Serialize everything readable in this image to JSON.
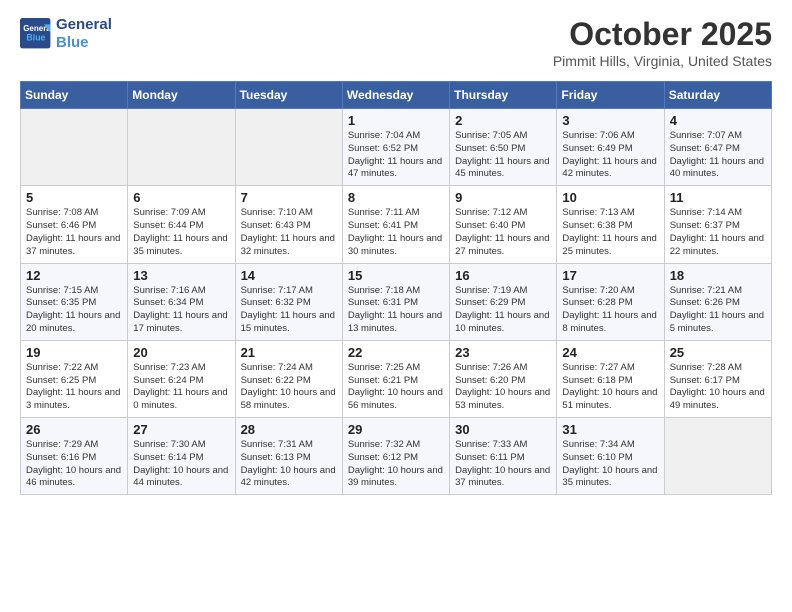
{
  "header": {
    "logo_line1": "General",
    "logo_line2": "Blue",
    "month": "October 2025",
    "location": "Pimmit Hills, Virginia, United States"
  },
  "days_of_week": [
    "Sunday",
    "Monday",
    "Tuesday",
    "Wednesday",
    "Thursday",
    "Friday",
    "Saturday"
  ],
  "weeks": [
    [
      {
        "day": "",
        "info": ""
      },
      {
        "day": "",
        "info": ""
      },
      {
        "day": "",
        "info": ""
      },
      {
        "day": "1",
        "info": "Sunrise: 7:04 AM\nSunset: 6:52 PM\nDaylight: 11 hours and 47 minutes."
      },
      {
        "day": "2",
        "info": "Sunrise: 7:05 AM\nSunset: 6:50 PM\nDaylight: 11 hours and 45 minutes."
      },
      {
        "day": "3",
        "info": "Sunrise: 7:06 AM\nSunset: 6:49 PM\nDaylight: 11 hours and 42 minutes."
      },
      {
        "day": "4",
        "info": "Sunrise: 7:07 AM\nSunset: 6:47 PM\nDaylight: 11 hours and 40 minutes."
      }
    ],
    [
      {
        "day": "5",
        "info": "Sunrise: 7:08 AM\nSunset: 6:46 PM\nDaylight: 11 hours and 37 minutes."
      },
      {
        "day": "6",
        "info": "Sunrise: 7:09 AM\nSunset: 6:44 PM\nDaylight: 11 hours and 35 minutes."
      },
      {
        "day": "7",
        "info": "Sunrise: 7:10 AM\nSunset: 6:43 PM\nDaylight: 11 hours and 32 minutes."
      },
      {
        "day": "8",
        "info": "Sunrise: 7:11 AM\nSunset: 6:41 PM\nDaylight: 11 hours and 30 minutes."
      },
      {
        "day": "9",
        "info": "Sunrise: 7:12 AM\nSunset: 6:40 PM\nDaylight: 11 hours and 27 minutes."
      },
      {
        "day": "10",
        "info": "Sunrise: 7:13 AM\nSunset: 6:38 PM\nDaylight: 11 hours and 25 minutes."
      },
      {
        "day": "11",
        "info": "Sunrise: 7:14 AM\nSunset: 6:37 PM\nDaylight: 11 hours and 22 minutes."
      }
    ],
    [
      {
        "day": "12",
        "info": "Sunrise: 7:15 AM\nSunset: 6:35 PM\nDaylight: 11 hours and 20 minutes."
      },
      {
        "day": "13",
        "info": "Sunrise: 7:16 AM\nSunset: 6:34 PM\nDaylight: 11 hours and 17 minutes."
      },
      {
        "day": "14",
        "info": "Sunrise: 7:17 AM\nSunset: 6:32 PM\nDaylight: 11 hours and 15 minutes."
      },
      {
        "day": "15",
        "info": "Sunrise: 7:18 AM\nSunset: 6:31 PM\nDaylight: 11 hours and 13 minutes."
      },
      {
        "day": "16",
        "info": "Sunrise: 7:19 AM\nSunset: 6:29 PM\nDaylight: 11 hours and 10 minutes."
      },
      {
        "day": "17",
        "info": "Sunrise: 7:20 AM\nSunset: 6:28 PM\nDaylight: 11 hours and 8 minutes."
      },
      {
        "day": "18",
        "info": "Sunrise: 7:21 AM\nSunset: 6:26 PM\nDaylight: 11 hours and 5 minutes."
      }
    ],
    [
      {
        "day": "19",
        "info": "Sunrise: 7:22 AM\nSunset: 6:25 PM\nDaylight: 11 hours and 3 minutes."
      },
      {
        "day": "20",
        "info": "Sunrise: 7:23 AM\nSunset: 6:24 PM\nDaylight: 11 hours and 0 minutes."
      },
      {
        "day": "21",
        "info": "Sunrise: 7:24 AM\nSunset: 6:22 PM\nDaylight: 10 hours and 58 minutes."
      },
      {
        "day": "22",
        "info": "Sunrise: 7:25 AM\nSunset: 6:21 PM\nDaylight: 10 hours and 56 minutes."
      },
      {
        "day": "23",
        "info": "Sunrise: 7:26 AM\nSunset: 6:20 PM\nDaylight: 10 hours and 53 minutes."
      },
      {
        "day": "24",
        "info": "Sunrise: 7:27 AM\nSunset: 6:18 PM\nDaylight: 10 hours and 51 minutes."
      },
      {
        "day": "25",
        "info": "Sunrise: 7:28 AM\nSunset: 6:17 PM\nDaylight: 10 hours and 49 minutes."
      }
    ],
    [
      {
        "day": "26",
        "info": "Sunrise: 7:29 AM\nSunset: 6:16 PM\nDaylight: 10 hours and 46 minutes."
      },
      {
        "day": "27",
        "info": "Sunrise: 7:30 AM\nSunset: 6:14 PM\nDaylight: 10 hours and 44 minutes."
      },
      {
        "day": "28",
        "info": "Sunrise: 7:31 AM\nSunset: 6:13 PM\nDaylight: 10 hours and 42 minutes."
      },
      {
        "day": "29",
        "info": "Sunrise: 7:32 AM\nSunset: 6:12 PM\nDaylight: 10 hours and 39 minutes."
      },
      {
        "day": "30",
        "info": "Sunrise: 7:33 AM\nSunset: 6:11 PM\nDaylight: 10 hours and 37 minutes."
      },
      {
        "day": "31",
        "info": "Sunrise: 7:34 AM\nSunset: 6:10 PM\nDaylight: 10 hours and 35 minutes."
      },
      {
        "day": "",
        "info": ""
      }
    ]
  ]
}
